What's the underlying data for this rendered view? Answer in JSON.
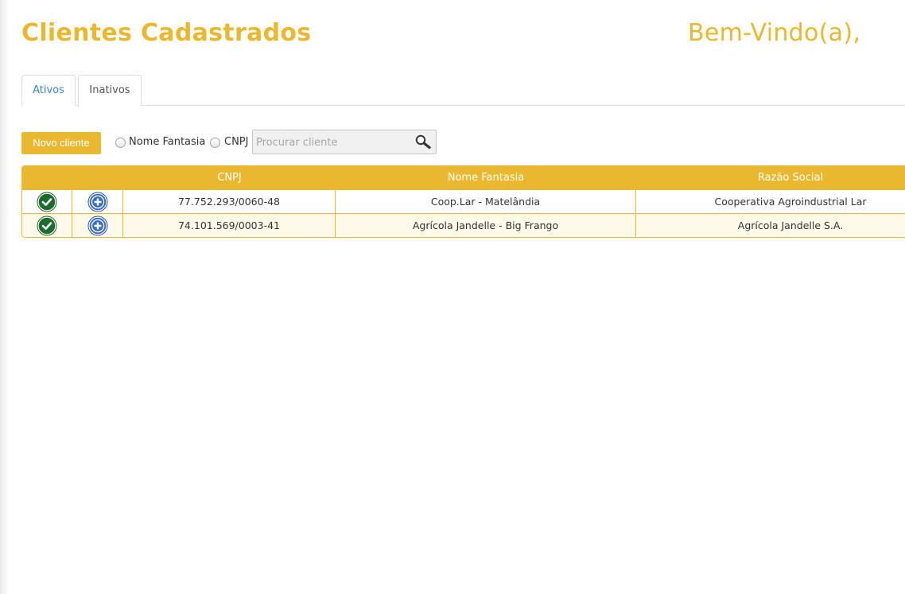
{
  "header": {
    "title": "Clientes Cadastrados",
    "welcome": "Bem-Vindo(a),"
  },
  "tabs": [
    {
      "label": "Ativos",
      "active": false
    },
    {
      "label": "Inativos",
      "active": true
    }
  ],
  "toolbar": {
    "new_client_label": "Novo cliente",
    "filter_options": [
      {
        "label": "Nome Fantasia",
        "checked": false
      },
      {
        "label": "CNPJ",
        "checked": false
      }
    ],
    "search_placeholder": "Procurar cliente",
    "search_value": ""
  },
  "table": {
    "columns": [
      "",
      "",
      "CNPJ",
      "Nome Fantasia",
      "Razão Social"
    ],
    "rows": [
      {
        "cnpj": "77.752.293/0060-48",
        "nome_fantasia": "Coop.Lar - Matelândia",
        "razao_social": "Cooperativa Agroindustrial Lar"
      },
      {
        "cnpj": "74.101.569/0003-41",
        "nome_fantasia": "Agrícola Jandelle - Big Frango",
        "razao_social": "Agrícola Jandelle S.A."
      }
    ]
  },
  "icons": {
    "activate": "check-circle-icon",
    "details": "plus-circle-icon",
    "search": "magnifier-icon"
  },
  "colors": {
    "accent": "#e9b82f",
    "link": "#3e86c4",
    "activate_green": "#1d6b2f",
    "details_blue": "#3b6fc4",
    "row_alt": "#fff9ea"
  }
}
